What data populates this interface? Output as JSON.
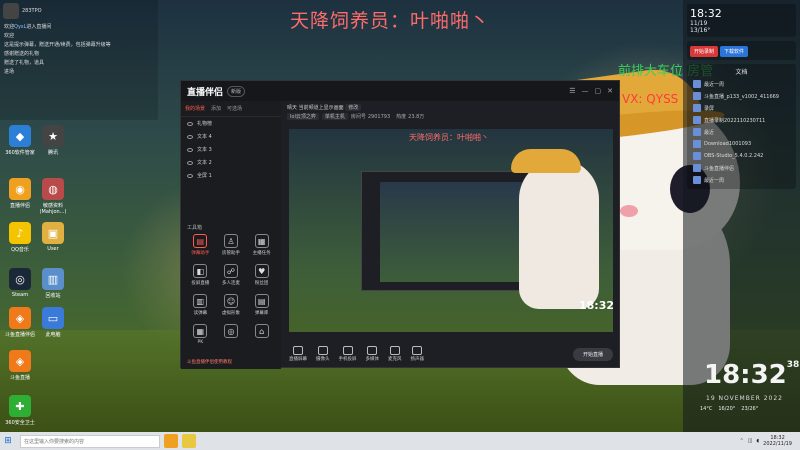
{
  "wallpaper": {
    "title_watermark": "天降饲养员：叶啪啪丶",
    "role_watermark": "前排大车位 房管",
    "vx_watermark": "VX: QYSS"
  },
  "chat": {
    "header": "283TPO",
    "lines": [
      {
        "user": "欢迎",
        "text": "欢迎",
        "highlight": "QysL",
        "tail": "进入直播间"
      },
      {
        "text": "欢迎"
      },
      {
        "text": "这是提示弹幕，赠送开通/续费，包括弹幕升级等"
      },
      {
        "text": "感谢赠送的礼物"
      },
      {
        "text": "赠送了礼物，道具"
      },
      {
        "text": "进场"
      }
    ]
  },
  "desktop_icons": [
    {
      "label": "360软件管家",
      "glyph": "◆",
      "color": "#2b7fd6"
    },
    {
      "label": "腾讯",
      "glyph": "★",
      "color": "#444"
    },
    {
      "label": "直播伴侣",
      "glyph": "◉",
      "color": "#f0a020"
    },
    {
      "label": "敏感资料 (Mahjon...)",
      "glyph": "◍",
      "color": "#b84a4a"
    },
    {
      "label": "QQ音乐",
      "glyph": "♪",
      "color": "#f5c400"
    },
    {
      "label": "User",
      "glyph": "▣",
      "color": "#e0b040"
    },
    {
      "label": "Steam",
      "glyph": "◎",
      "color": "#1b2838"
    },
    {
      "label": "回收站",
      "glyph": "▥",
      "color": "#5a8fcc"
    },
    {
      "label": "斗鱼直播伴侣",
      "glyph": "◈",
      "color": "#f07a1a"
    },
    {
      "label": "此电脑",
      "glyph": "▭",
      "color": "#3a7ad8"
    },
    {
      "label": "斗鱼直播",
      "glyph": "◈",
      "color": "#f07a1a"
    },
    {
      "label": "360安全卫士",
      "glyph": "✚",
      "color": "#2fae36"
    }
  ],
  "app": {
    "logo": "直播伴侣",
    "version": "新版",
    "window_controls": [
      "☰",
      "—",
      "▢",
      "✕"
    ],
    "sidebar_tabs": [
      {
        "label": "我的场景",
        "on": true
      },
      {
        "label": "添加",
        "on": false
      },
      {
        "label": "可选场",
        "on": false
      }
    ],
    "layers": [
      "礼物榜",
      "文本 4",
      "文本 3",
      "文本 2",
      "全屏 1"
    ],
    "toolbox_title": "工具箱",
    "tools": [
      {
        "label": "弹幕助手",
        "glyph": "▤",
        "active": true
      },
      {
        "label": "房管助手",
        "glyph": "♙",
        "active": false
      },
      {
        "label": "主播任务",
        "glyph": "▦",
        "active": false
      },
      {
        "label": "投屏直播",
        "glyph": "◧",
        "active": false
      },
      {
        "label": "多人连麦",
        "glyph": "☍",
        "active": false
      },
      {
        "label": "粉丝团",
        "glyph": "♥",
        "active": false
      },
      {
        "label": "读弹幕",
        "glyph": "▥",
        "active": false
      },
      {
        "label": "虚拟形象",
        "glyph": "☺",
        "active": false
      },
      {
        "label": "弹幕库",
        "glyph": "▤",
        "active": false
      },
      {
        "label": "PK",
        "glyph": "▦",
        "active": false
      },
      {
        "label": "",
        "glyph": "◎",
        "active": false
      },
      {
        "label": "",
        "glyph": "⌂",
        "active": false
      }
    ],
    "sidebar_footer": "斗鱼直播伴侣使用教程",
    "info": {
      "title": "晴天  当前频道上显示画面",
      "edit": "修改",
      "tags": [
        "lol云顶之弈",
        "单机主机"
      ],
      "stats": [
        {
          "label": "房间号",
          "value": "2901793"
        },
        {
          "label": "热度",
          "value": "23.8万"
        }
      ]
    },
    "preview": {
      "overlay_title": "天降饲养员：叶啪啪丶",
      "time": "18:32"
    },
    "controls": [
      "直播屏幕",
      "摄像头",
      "手机投屏",
      "多媒体",
      "麦克风",
      "扬声器"
    ],
    "go_live": "开始直播"
  },
  "right_panel": {
    "time": "18:32",
    "date": "11/19",
    "weather": "13/16°",
    "btn_primary": "开始录制",
    "btn_secondary": "下载软件",
    "folder_title": "文档",
    "files": [
      "最近一周",
      "斗鱼直播_p133_v1002_411669",
      "录屏",
      "直播录制2022110230711",
      "最近",
      "Download1001093",
      "OBS-Studio_5.4.0.2.242",
      "斗鱼直播伴侣",
      "最近一周"
    ]
  },
  "big_clock": {
    "time": "18:32",
    "seconds": "38",
    "date": "19 NOVEMBER 2022"
  },
  "weather_strip": [
    "14°C",
    "16/20°",
    "23/26°"
  ],
  "taskbar": {
    "search_placeholder": "在这里输入你要搜索的内容",
    "time": "18:32",
    "date": "2022/11/19"
  }
}
